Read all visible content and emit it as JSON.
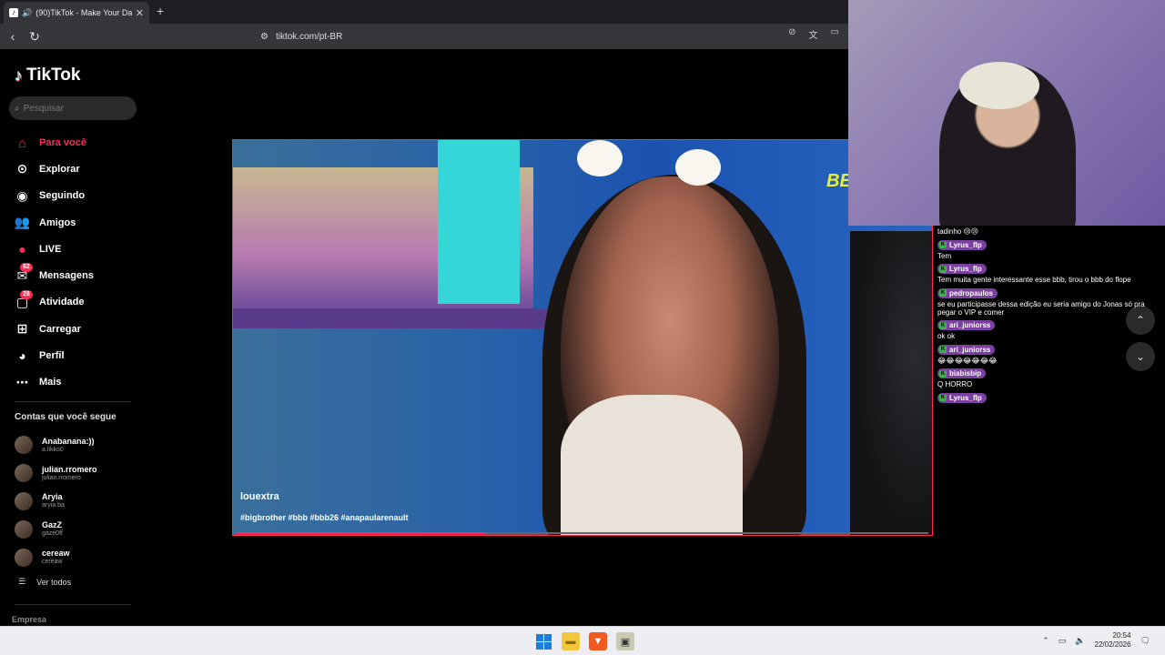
{
  "browser": {
    "tab_title": "(90)TikTok - Make Your Day",
    "url": "tiktok.com/pt-BR"
  },
  "sidebar": {
    "logo": "TikTok",
    "search_placeholder": "Pesquisar",
    "nav": [
      {
        "label": "Para você",
        "icon": "home-icon",
        "active": true
      },
      {
        "label": "Explorar",
        "icon": "compass-icon"
      },
      {
        "label": "Seguindo",
        "icon": "following-icon"
      },
      {
        "label": "Amigos",
        "icon": "friends-icon"
      },
      {
        "label": "LIVE",
        "icon": "live-icon"
      },
      {
        "label": "Mensagens",
        "icon": "messages-icon",
        "badge": "62"
      },
      {
        "label": "Atividade",
        "icon": "activity-icon",
        "badge": "28"
      },
      {
        "label": "Carregar",
        "icon": "upload-icon"
      },
      {
        "label": "Perfil",
        "icon": "profile-icon"
      },
      {
        "label": "Mais",
        "icon": "more-icon"
      }
    ],
    "following_title": "Contas que você segue",
    "following": [
      {
        "name": "Anabanana:))",
        "user": "a.likko0"
      },
      {
        "name": "julian.rromero",
        "user": "julian.rromero"
      },
      {
        "name": "Aryia",
        "user": "aryia.ba"
      },
      {
        "name": "GazZ",
        "user": "gaze0ff"
      },
      {
        "name": "cereaw",
        "user": "cereaw"
      }
    ],
    "see_all": "Ver todos",
    "footer_company": "Empresa"
  },
  "video": {
    "author": "louextra",
    "hashtags": "#bigbrother #bbb #bbb26 #anapaularenault",
    "overlay_logo": "BE",
    "progress": 0.36
  },
  "chat": {
    "messages": [
      {
        "user": "",
        "text": "tadinho 😢😢"
      },
      {
        "user": "Lyrus_flp",
        "text": "Tem"
      },
      {
        "user": "Lyrus_flp",
        "text": "Tem muita gente interessante esse bbb, tirou o bbb do flope"
      },
      {
        "user": "pedropaulos",
        "text": "se eu participasse dessa edição eu seria amigo do Jonas só pra pegar o VIP e comer"
      },
      {
        "user": "ari_juniorss",
        "text": "ok ok"
      },
      {
        "user": "ari_juniorss",
        "text": "😂😂😂😂😂😂😂"
      },
      {
        "user": "biabisbip",
        "text": "Q HORRO"
      },
      {
        "user": "Lyrus_flp",
        "text": ""
      }
    ]
  },
  "taskbar": {
    "time": "20:54",
    "date": "22/02/2026"
  },
  "colors": {
    "accent": "#fe2c55",
    "chat_name_bg": "#7a3fa0",
    "taskbar_bg": "#eeeef2"
  }
}
